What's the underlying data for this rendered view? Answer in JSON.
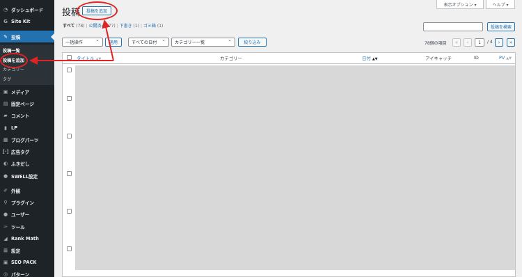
{
  "sidebar": {
    "items": [
      {
        "label": "ダッシュボード",
        "icon": "dashboard-icon",
        "glyph": "◔"
      },
      {
        "label": "Site Kit",
        "icon": "google-icon",
        "glyph": "G"
      },
      {
        "label": "投稿",
        "icon": "pin-icon",
        "glyph": "✎",
        "active": true
      },
      {
        "label": "メディア",
        "icon": "media-icon",
        "glyph": "▣"
      },
      {
        "label": "固定ページ",
        "icon": "page-icon",
        "glyph": "▤"
      },
      {
        "label": "コメント",
        "icon": "comment-icon",
        "glyph": "▰"
      },
      {
        "label": "LP",
        "icon": "document-icon",
        "glyph": "▮"
      },
      {
        "label": "ブログパーツ",
        "icon": "grid-icon",
        "glyph": "▦"
      },
      {
        "label": "広告タグ",
        "icon": "code-icon",
        "glyph": "[·]"
      },
      {
        "label": "ふきだし",
        "icon": "bubble-icon",
        "glyph": "◐"
      },
      {
        "label": "SWELL設定",
        "icon": "swell-icon",
        "glyph": "●"
      },
      {
        "label": "外観",
        "icon": "brush-icon",
        "glyph": "✐"
      },
      {
        "label": "プラグイン",
        "icon": "plugin-icon",
        "glyph": "⚲"
      },
      {
        "label": "ユーザー",
        "icon": "user-icon",
        "glyph": "●"
      },
      {
        "label": "ツール",
        "icon": "wrench-icon",
        "glyph": "✑"
      },
      {
        "label": "Rank Math",
        "icon": "chart-icon",
        "glyph": "◢"
      },
      {
        "label": "設定",
        "icon": "settings-icon",
        "glyph": "⊞"
      },
      {
        "label": "SEO PACK",
        "icon": "seo-icon",
        "glyph": "▣"
      },
      {
        "label": "パターン",
        "icon": "pattern-icon",
        "glyph": "◎"
      }
    ],
    "submenu": [
      "投稿一覧",
      "投稿を追加",
      "カテゴリー",
      "タグ"
    ]
  },
  "header": {
    "title": "投稿",
    "add_new": "投稿を追加",
    "screen_options": "表示オプション ▾",
    "help": "ヘルプ ▾"
  },
  "filters": {
    "all": "すべて",
    "all_count": "(78)",
    "published": "公開済み",
    "published_count": "(77)",
    "draft": "下書き",
    "draft_count": "(1)",
    "trash": "ゴミ箱",
    "trash_count": "(1)"
  },
  "search": {
    "button": "投稿を検索",
    "value": ""
  },
  "bulk": {
    "action": "一括操作",
    "apply": "適用",
    "dates": "すべての日付",
    "category": "カテゴリー一覧",
    "filter": "絞り込み"
  },
  "pagination": {
    "count": "78個の項目",
    "current": "1",
    "total": "/ 4"
  },
  "table": {
    "col_title": "タイトル",
    "col_category": "カテゴリー",
    "col_date": "日付",
    "col_eyecatch": "アイキャッチ",
    "col_id": "ID",
    "col_pv": "PV"
  },
  "colors": {
    "accent": "#2271b1",
    "sidebar": "#1d2327",
    "annotation": "#e02424",
    "redacted": "#d8d8d8"
  }
}
